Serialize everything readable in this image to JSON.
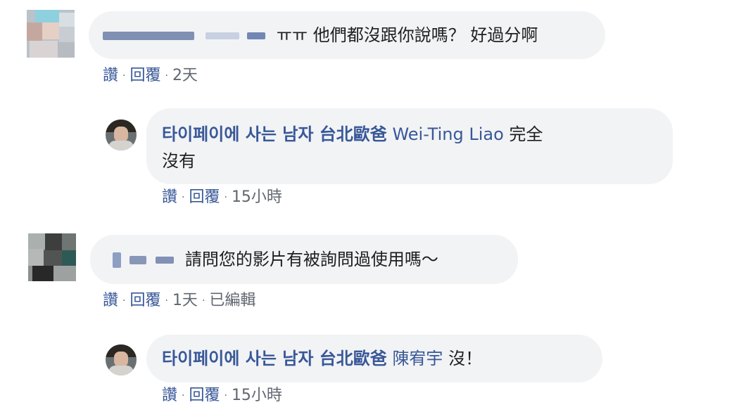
{
  "comments": [
    {
      "author": "",
      "text": "ㅠㅠ 他們都沒跟你說嗎？ 好過分啊",
      "actions": {
        "like": "讚",
        "reply": "回覆",
        "time": "2天",
        "edited": ""
      }
    },
    {
      "author": "타이페이에 사는 남자 台北歐爸",
      "tag": "Wei-Ting Liao",
      "text_line1": "完全",
      "text_line2": "沒有",
      "actions": {
        "like": "讚",
        "reply": "回覆",
        "time": "15小時",
        "edited": ""
      }
    },
    {
      "author": "",
      "text": "請問您的影片有被詢問過使用嗎～",
      "actions": {
        "like": "讚",
        "reply": "回覆",
        "time": "1天",
        "edited": "已編輯"
      }
    },
    {
      "author": "타이페이에 사는 남자 台北歐爸",
      "tag": "陳宥宇",
      "text": "沒！",
      "actions": {
        "like": "讚",
        "reply": "回覆",
        "time": "15小時",
        "edited": ""
      }
    }
  ],
  "colors": {
    "bubble": "#f2f3f5",
    "name": "#385898",
    "meta": "#606770",
    "text": "#1c1e21"
  }
}
